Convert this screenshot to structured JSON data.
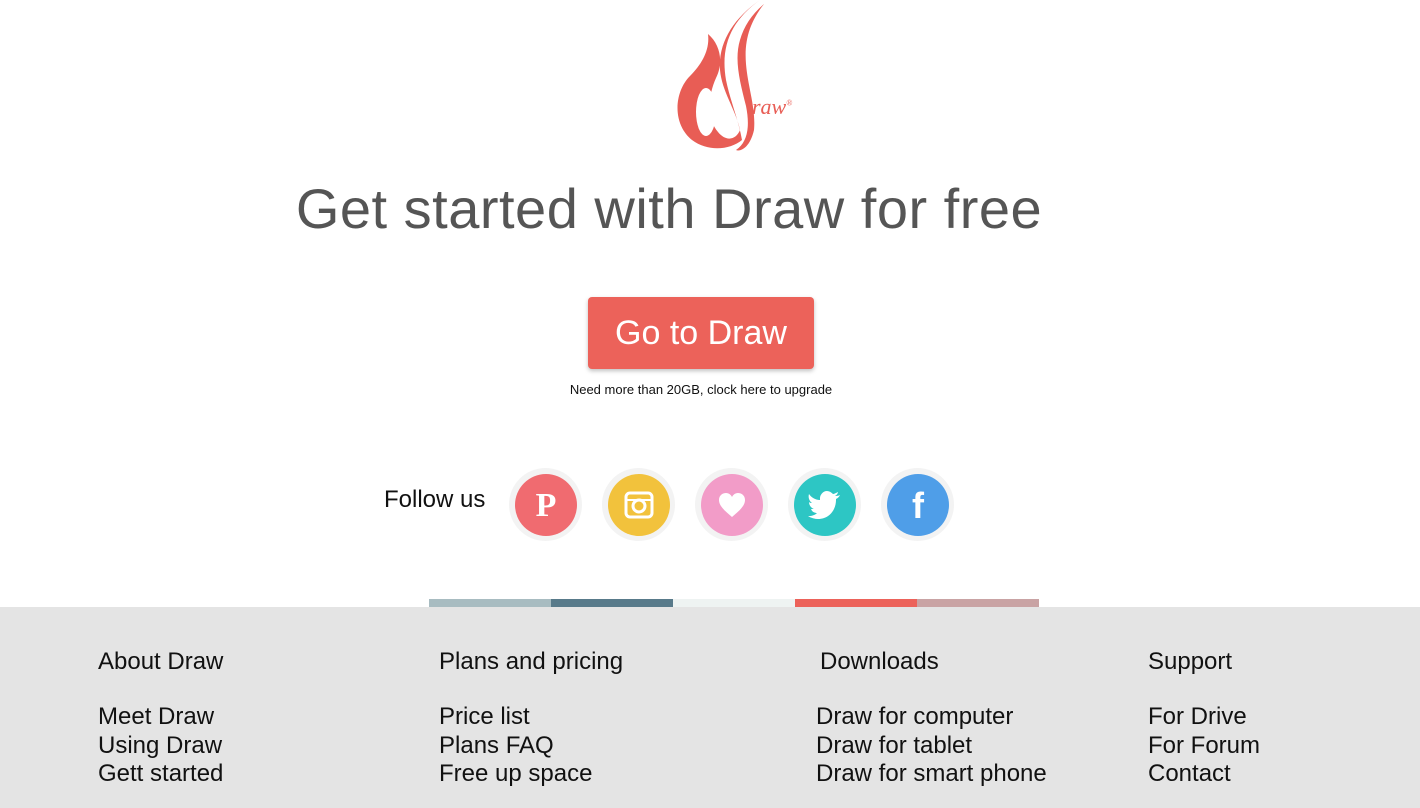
{
  "brand": {
    "logo_text": "raw",
    "mark": "®",
    "color": "#e85d55"
  },
  "headline": "Get started with Draw for free",
  "cta": {
    "label": "Go to Draw",
    "color": "#ec625a"
  },
  "upgrade_text": "Need more than 20GB, clock here to upgrade",
  "follow": {
    "label": "Follow us",
    "networks": [
      "pinterest-icon",
      "instagram-icon",
      "heart-icon",
      "twitter-icon",
      "facebook-icon"
    ]
  },
  "colorbar": [
    "#a8bcc1",
    "#587a8a",
    "#eef3f2",
    "#ec625a",
    "#c9a3a4"
  ],
  "footer": {
    "columns": [
      {
        "title": "About Draw",
        "links": [
          "Meet Draw",
          "Using Draw",
          "Gett started"
        ]
      },
      {
        "title": "Plans and pricing",
        "links": [
          "Price list",
          "Plans FAQ",
          "Free up space"
        ]
      },
      {
        "title": "Downloads",
        "links": [
          "Draw for computer",
          "Draw for tablet",
          "Draw for smart phone"
        ]
      },
      {
        "title": "Support",
        "links": [
          "For Drive",
          "For Forum",
          "Contact"
        ]
      }
    ]
  }
}
